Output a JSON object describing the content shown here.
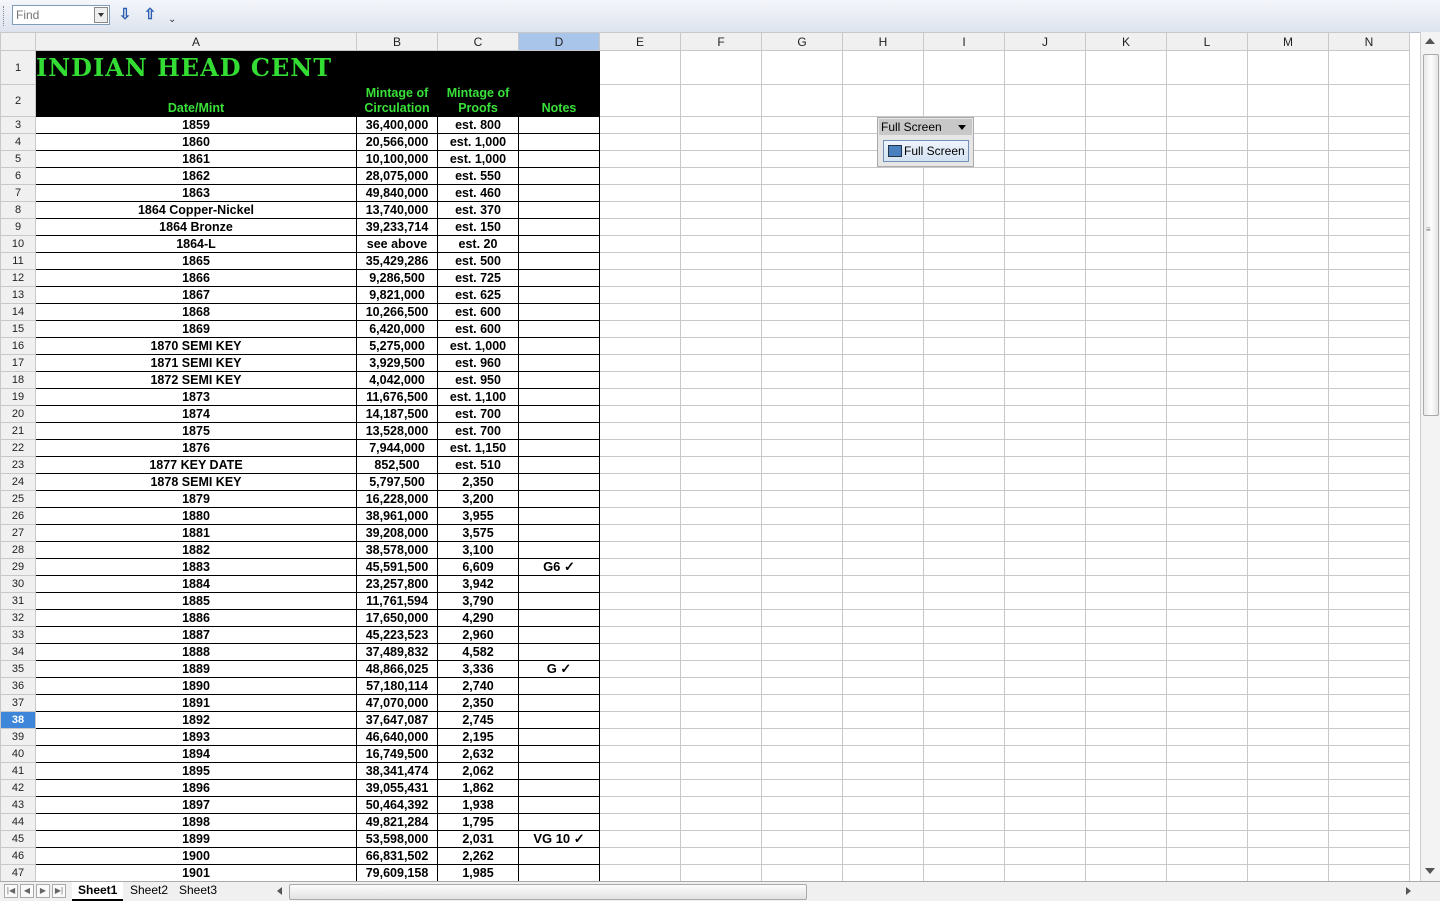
{
  "find_toolbar": {
    "placeholder": "Find",
    "find_next_icon": "arrow-down-icon",
    "find_prev_icon": "arrow-up-icon"
  },
  "columns": [
    "A",
    "B",
    "C",
    "D",
    "E",
    "F",
    "G",
    "H",
    "I",
    "J",
    "K",
    "L",
    "M",
    "N"
  ],
  "selected_column": "D",
  "selected_row": 38,
  "colors": {
    "header_bg": "#000000",
    "header_text": "#39e039",
    "row_selected": "#3d86d9"
  },
  "sheet": {
    "title": "INDIAN HEAD CENT",
    "headers": {
      "date_mint": "Date/Mint",
      "circulation": "Mintage of Circulation",
      "proofs": "Mintage of Proofs",
      "notes": "Notes"
    },
    "rows": [
      {
        "r": 3,
        "date": "1859",
        "circ": "36,400,000",
        "proof": "est. 800",
        "notes": ""
      },
      {
        "r": 4,
        "date": "1860",
        "circ": "20,566,000",
        "proof": "est. 1,000",
        "notes": ""
      },
      {
        "r": 5,
        "date": "1861",
        "circ": "10,100,000",
        "proof": "est. 1,000",
        "notes": ""
      },
      {
        "r": 6,
        "date": "1862",
        "circ": "28,075,000",
        "proof": "est. 550",
        "notes": ""
      },
      {
        "r": 7,
        "date": "1863",
        "circ": "49,840,000",
        "proof": "est. 460",
        "notes": ""
      },
      {
        "r": 8,
        "date": "1864 Copper-Nickel",
        "circ": "13,740,000",
        "proof": "est. 370",
        "notes": ""
      },
      {
        "r": 9,
        "date": "1864 Bronze",
        "circ": "39,233,714",
        "proof": "est. 150",
        "notes": ""
      },
      {
        "r": 10,
        "date": "1864-L",
        "circ": "see above",
        "proof": "est. 20",
        "notes": ""
      },
      {
        "r": 11,
        "date": "1865",
        "circ": "35,429,286",
        "proof": "est. 500",
        "notes": ""
      },
      {
        "r": 12,
        "date": "1866",
        "circ": "9,286,500",
        "proof": "est. 725",
        "notes": ""
      },
      {
        "r": 13,
        "date": "1867",
        "circ": "9,821,000",
        "proof": "est. 625",
        "notes": ""
      },
      {
        "r": 14,
        "date": "1868",
        "circ": "10,266,500",
        "proof": "est. 600",
        "notes": ""
      },
      {
        "r": 15,
        "date": "1869",
        "circ": "6,420,000",
        "proof": "est. 600",
        "notes": ""
      },
      {
        "r": 16,
        "date": "1870  SEMI KEY",
        "circ": "5,275,000",
        "proof": "est. 1,000",
        "notes": ""
      },
      {
        "r": 17,
        "date": "1871  SEMI KEY",
        "circ": "3,929,500",
        "proof": "est. 960",
        "notes": ""
      },
      {
        "r": 18,
        "date": "1872  SEMI KEY",
        "circ": "4,042,000",
        "proof": "est. 950",
        "notes": ""
      },
      {
        "r": 19,
        "date": "1873",
        "circ": "11,676,500",
        "proof": "est. 1,100",
        "notes": ""
      },
      {
        "r": 20,
        "date": "1874",
        "circ": "14,187,500",
        "proof": "est. 700",
        "notes": ""
      },
      {
        "r": 21,
        "date": "1875",
        "circ": "13,528,000",
        "proof": "est. 700",
        "notes": ""
      },
      {
        "r": 22,
        "date": "1876",
        "circ": "7,944,000",
        "proof": "est. 1,150",
        "notes": ""
      },
      {
        "r": 23,
        "date": "1877  KEY DATE",
        "circ": "852,500",
        "proof": "est. 510",
        "notes": ""
      },
      {
        "r": 24,
        "date": "1878  SEMI KEY",
        "circ": "5,797,500",
        "proof": "2,350",
        "notes": ""
      },
      {
        "r": 25,
        "date": "1879",
        "circ": "16,228,000",
        "proof": "3,200",
        "notes": ""
      },
      {
        "r": 26,
        "date": "1880",
        "circ": "38,961,000",
        "proof": "3,955",
        "notes": ""
      },
      {
        "r": 27,
        "date": "1881",
        "circ": "39,208,000",
        "proof": "3,575",
        "notes": ""
      },
      {
        "r": 28,
        "date": "1882",
        "circ": "38,578,000",
        "proof": "3,100",
        "notes": ""
      },
      {
        "r": 29,
        "date": "1883",
        "circ": "45,591,500",
        "proof": "6,609",
        "notes": "G6 ✓"
      },
      {
        "r": 30,
        "date": "1884",
        "circ": "23,257,800",
        "proof": "3,942",
        "notes": ""
      },
      {
        "r": 31,
        "date": "1885",
        "circ": "11,761,594",
        "proof": "3,790",
        "notes": ""
      },
      {
        "r": 32,
        "date": "1886",
        "circ": "17,650,000",
        "proof": "4,290",
        "notes": ""
      },
      {
        "r": 33,
        "date": "1887",
        "circ": "45,223,523",
        "proof": "2,960",
        "notes": ""
      },
      {
        "r": 34,
        "date": "1888",
        "circ": "37,489,832",
        "proof": "4,582",
        "notes": ""
      },
      {
        "r": 35,
        "date": "1889",
        "circ": "48,866,025",
        "proof": "3,336",
        "notes": "G ✓"
      },
      {
        "r": 36,
        "date": "1890",
        "circ": "57,180,114",
        "proof": "2,740",
        "notes": ""
      },
      {
        "r": 37,
        "date": "1891",
        "circ": "47,070,000",
        "proof": "2,350",
        "notes": ""
      },
      {
        "r": 38,
        "date": "1892",
        "circ": "37,647,087",
        "proof": "2,745",
        "notes": ""
      },
      {
        "r": 39,
        "date": "1893",
        "circ": "46,640,000",
        "proof": "2,195",
        "notes": ""
      },
      {
        "r": 40,
        "date": "1894",
        "circ": "16,749,500",
        "proof": "2,632",
        "notes": ""
      },
      {
        "r": 41,
        "date": "1895",
        "circ": "38,341,474",
        "proof": "2,062",
        "notes": ""
      },
      {
        "r": 42,
        "date": "1896",
        "circ": "39,055,431",
        "proof": "1,862",
        "notes": ""
      },
      {
        "r": 43,
        "date": "1897",
        "circ": "50,464,392",
        "proof": "1,938",
        "notes": ""
      },
      {
        "r": 44,
        "date": "1898",
        "circ": "49,821,284",
        "proof": "1,795",
        "notes": ""
      },
      {
        "r": 45,
        "date": "1899",
        "circ": "53,598,000",
        "proof": "2,031",
        "notes": "VG 10 ✓"
      },
      {
        "r": 46,
        "date": "1900",
        "circ": "66,831,502",
        "proof": "2,262",
        "notes": ""
      },
      {
        "r": 47,
        "date": "1901",
        "circ": "79,609,158",
        "proof": "1,985",
        "notes": ""
      }
    ]
  },
  "floating_toolbar": {
    "title": "Full Screen",
    "button_label": "Full Screen",
    "icon": "full-screen-icon"
  },
  "sheet_tabs": [
    {
      "label": "Sheet1",
      "active": true
    },
    {
      "label": "Sheet2",
      "active": false
    },
    {
      "label": "Sheet3",
      "active": false
    }
  ]
}
